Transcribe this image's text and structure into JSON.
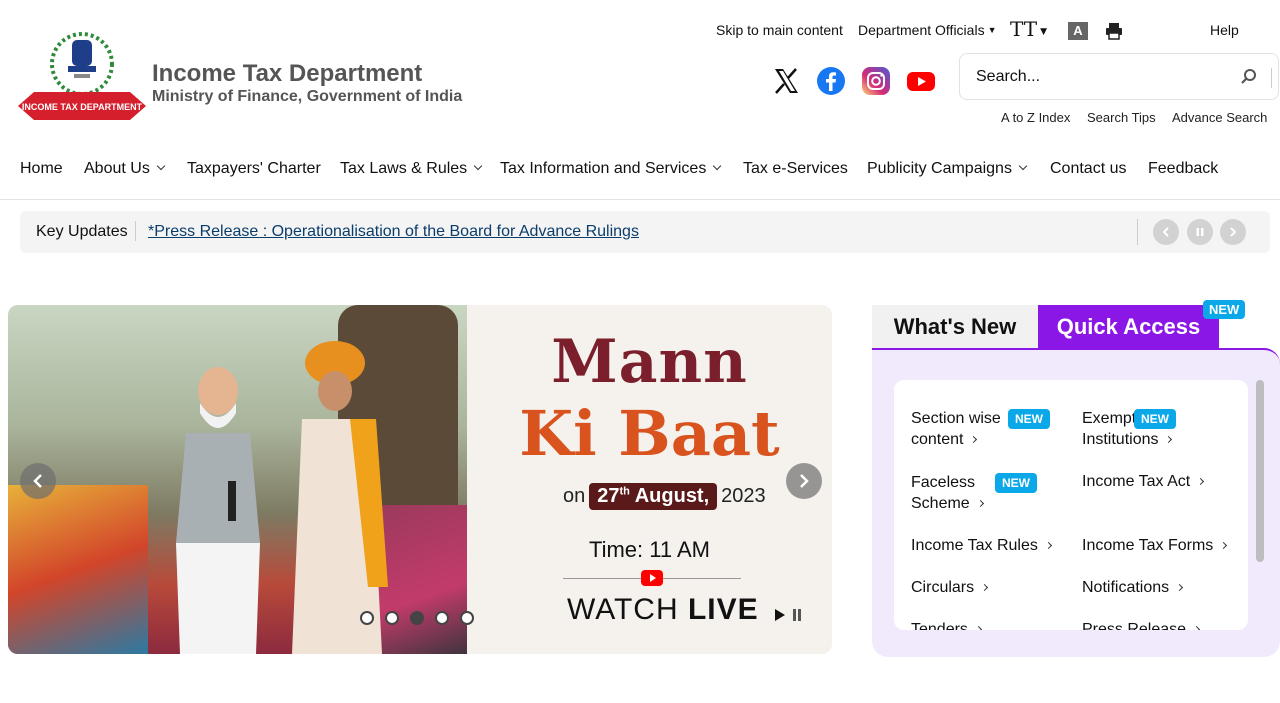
{
  "header": {
    "title": "Income Tax Department",
    "subtitle": "Ministry of Finance, Government of India",
    "logo_banner_text": "INCOME TAX DEPARTMENT"
  },
  "utility": {
    "skip": "Skip to main content",
    "officials": "Department Officials",
    "text_size": "TT",
    "contrast": "A",
    "help": "Help"
  },
  "social": [
    "x-icon",
    "facebook-icon",
    "instagram-icon",
    "youtube-icon"
  ],
  "search": {
    "placeholder": "Search...",
    "links": [
      "A to Z Index",
      "Search Tips",
      "Advance Search"
    ]
  },
  "nav": {
    "items": [
      {
        "label": "Home",
        "dropdown": false
      },
      {
        "label": "About Us",
        "dropdown": true
      },
      {
        "label": "Taxpayers' Charter",
        "dropdown": false
      },
      {
        "label": "Tax Laws & Rules",
        "dropdown": true
      },
      {
        "label": "Tax Information and Services",
        "dropdown": true
      },
      {
        "label": "Tax e-Services",
        "dropdown": false
      },
      {
        "label": "Publicity Campaigns",
        "dropdown": true
      },
      {
        "label": "Contact us",
        "dropdown": false
      },
      {
        "label": "Feedback",
        "dropdown": false
      }
    ]
  },
  "key_updates": {
    "label": "Key Updates",
    "text": "*Press Release : Operationalisation of the Board for Advance Rulings"
  },
  "banner": {
    "title_line1": "Mann",
    "title_line2": "Ki Baat",
    "date_prefix": "on",
    "date_day": "27",
    "date_suffix": "th",
    "date_month": "August,",
    "date_year": "2023",
    "time": "Time: 11 AM",
    "watch": "WATCH",
    "live": "LIVE",
    "slide_count": 5
  },
  "panel": {
    "tab_whats_new": "What's New",
    "tab_quick_access": "Quick Access",
    "tab_badge": "NEW",
    "items": [
      {
        "line1": "Section wise",
        "line2": "content",
        "is_new": true,
        "new_label": "NEW"
      },
      {
        "line1": "Exempt",
        "line2": "Institutions",
        "is_new": true,
        "new_label": "NEW"
      },
      {
        "line1": "Faceless",
        "line2": "Scheme",
        "is_new": true,
        "new_label": "NEW"
      },
      {
        "line1": "Income Tax Act",
        "is_new": false
      },
      {
        "line1": "Income Tax Rules",
        "is_new": false
      },
      {
        "line1": "Income Tax Forms",
        "is_new": false
      },
      {
        "line1": "Circulars",
        "is_new": false
      },
      {
        "line1": "Notifications",
        "is_new": false
      },
      {
        "line1": "Tenders",
        "is_new": false
      },
      {
        "line1": "Press Release",
        "is_new": false
      }
    ]
  },
  "colors": {
    "accent_purple": "#8b17e6",
    "new_badge": "#0aa8e8",
    "link_blue": "#0b3d6b"
  }
}
